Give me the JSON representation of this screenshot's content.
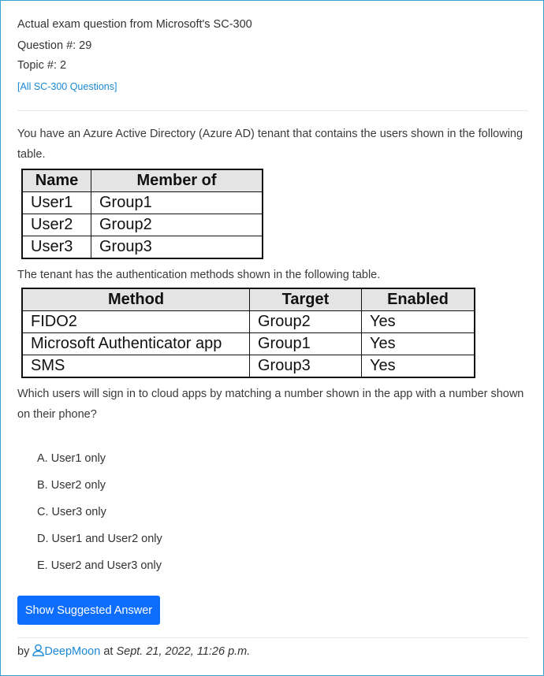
{
  "header": {
    "exam_line": "Actual exam question from Microsoft's SC-300",
    "question_line": "Question #: 29",
    "topic_line": "Topic #: 2",
    "all_questions_link": "[All SC-300 Questions]"
  },
  "question": {
    "intro": "You have an Azure Active Directory (Azure AD) tenant that contains the users shown in the following table.",
    "users_table": {
      "headers": [
        "Name",
        "Member of"
      ],
      "rows": [
        [
          "User1",
          "Group1"
        ],
        [
          "User2",
          "Group2"
        ],
        [
          "User3",
          "Group3"
        ]
      ]
    },
    "methods_intro": "The tenant has the authentication methods shown in the following table.",
    "methods_table": {
      "headers": [
        "Method",
        "Target",
        "Enabled"
      ],
      "rows": [
        [
          "FIDO2",
          "Group2",
          "Yes"
        ],
        [
          "Microsoft Authenticator app",
          "Group1",
          "Yes"
        ],
        [
          "SMS",
          "Group3",
          "Yes"
        ]
      ]
    },
    "prompt": "Which users will sign in to cloud apps by matching a number shown in the app with a number shown on their phone?",
    "choices": [
      "A. User1 only",
      "B. User2 only",
      "C. User3 only",
      "D. User1 and User2 only",
      "E. User2 and User3 only"
    ]
  },
  "actions": {
    "show_answer_label": "Show Suggested Answer"
  },
  "footer": {
    "by": "by",
    "username": "DeepMoon",
    "at": "at",
    "date": "Sept. 21, 2022, 11:26 p.m."
  },
  "colors": {
    "link": "#1a88d6",
    "button": "#0d6efd",
    "frame": "#3aa0d8"
  }
}
